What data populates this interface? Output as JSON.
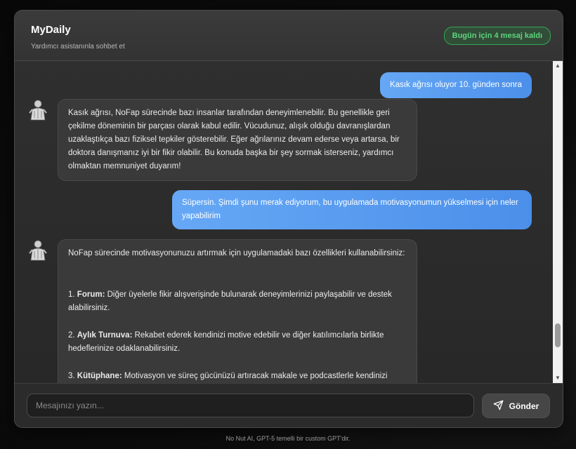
{
  "header": {
    "title": "MyDaily",
    "subtitle": "Yardımcı asistanınla sohbet et",
    "quota_badge": "Bugün için 4 mesaj kaldı"
  },
  "messages": [
    {
      "role": "user",
      "text": "Kasık ağrısı oluyor 10. günden sonra"
    },
    {
      "role": "assistant",
      "text": "Kasık ağrısı, NoFap sürecinde bazı insanlar tarafından deneyimlenebilir. Bu genellikle geri çekilme döneminin bir parçası olarak kabul edilir. Vücudunuz, alışık olduğu davranışlardan uzaklaştıkça bazı fiziksel tepkiler gösterebilir. Eğer ağrılarınız devam ederse veya artarsa, bir doktora danışmanız iyi bir fikir olabilir. Bu konuda başka bir şey sormak isterseniz, yardımcı olmaktan memnuniyet duyarım!"
    },
    {
      "role": "user",
      "text": "Süpersin. Şimdi şunu merak ediyorum, bu uygulamada motivasyonumun yükselmesi için neler yapabilirim"
    },
    {
      "role": "assistant",
      "intro": "NoFap sürecinde motivasyonunuzu artırmak için uygulamadaki bazı özellikleri kullanabilirsiniz:",
      "items": [
        {
          "num": "1.",
          "title": "Forum:",
          "text": "Diğer üyelerle fikir alışverişinde bulunarak deneyimlerinizi paylaşabilir ve destek alabilirsiniz."
        },
        {
          "num": "2.",
          "title": "Aylık Turnuva:",
          "text": "Rekabet ederek kendinizi motive edebilir ve diğer katılımcılarla birlikte hedeflerinize odaklanabilirsiniz."
        },
        {
          "num": "3.",
          "title": "Kütüphane:",
          "text": "Motivasyon ve süreç gücünüzü artıracak makale ve podcastlerle kendinizi bilgilendirebilirsiniz."
        }
      ]
    }
  ],
  "composer": {
    "placeholder": "Mesajınızı yazın...",
    "send_label": "Gönder"
  },
  "footer": "No Nut AI, GPT-5 temelli bir custom GPT'dir.",
  "colors": {
    "user_bubble": "#5a9cf0",
    "badge_green": "#5fd47e"
  },
  "icons": {
    "avatar": "athlete-avatar-icon",
    "send": "send-paper-plane-icon"
  }
}
